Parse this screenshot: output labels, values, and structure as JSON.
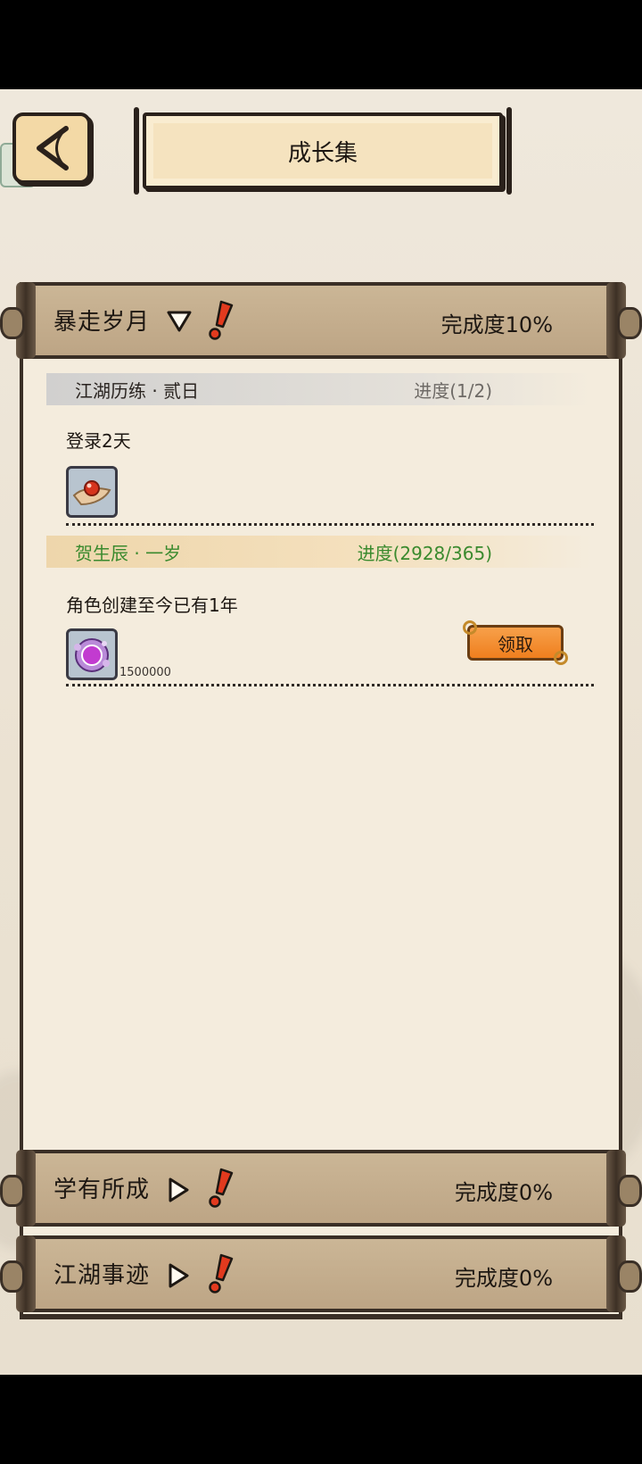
{
  "title": "成长集",
  "sections": [
    {
      "name": "暴走岁月",
      "completion": "完成度10%",
      "expanded": true,
      "tasks": [
        {
          "name": "江湖历练 · 贰日",
          "progress": "进度(1/2)",
          "description": "登录2天",
          "reward_icon": "red-orb-on-cloth-icon",
          "reward_qty": "",
          "claimable": false
        },
        {
          "name": "贺生辰 · 一岁",
          "progress": "进度(2928/365)",
          "description": "角色创建至今已有1年",
          "reward_icon": "purple-orb-icon",
          "reward_qty": "1500000",
          "claimable": true,
          "claim_label": "领取"
        }
      ]
    },
    {
      "name": "学有所成",
      "completion": "完成度0%",
      "expanded": false
    },
    {
      "name": "江湖事迹",
      "completion": "完成度0%",
      "expanded": false
    }
  ],
  "colors": {
    "header_bg": "#c4ae8e",
    "panel_bg": "#f4ecdd",
    "progress_green": "#3a8a2e",
    "claim_orange": "#f28a2a",
    "alert_red": "#e23a1e"
  }
}
